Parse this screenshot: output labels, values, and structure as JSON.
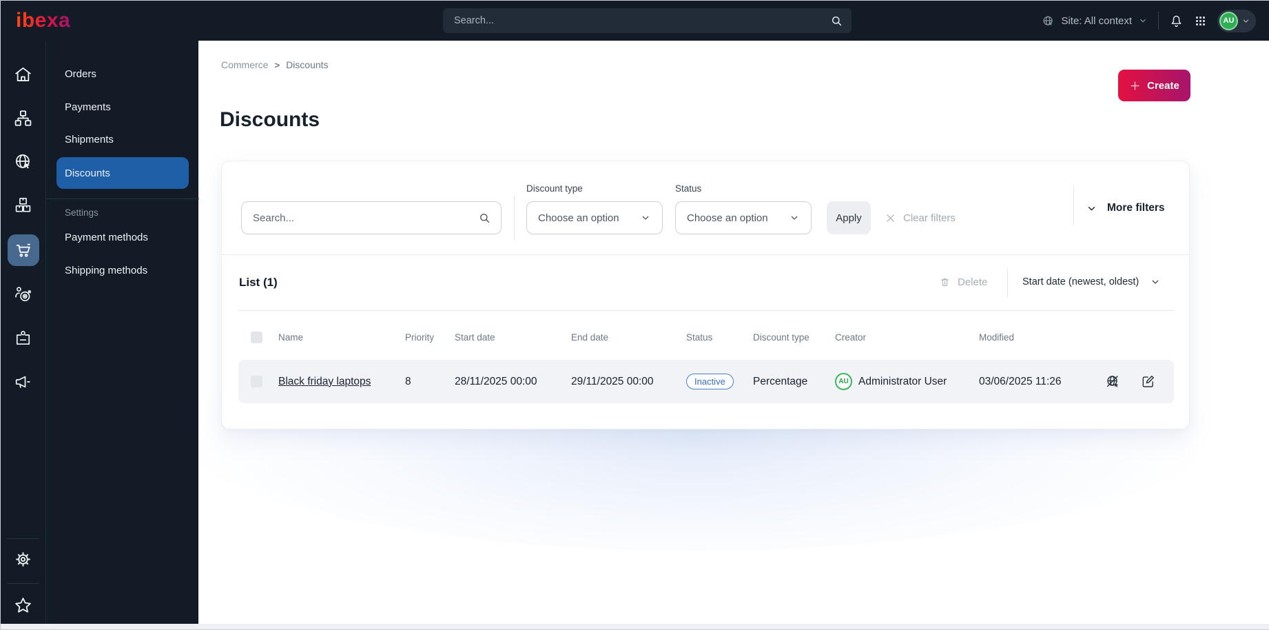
{
  "colors": {
    "topbar_bg": "#131c26",
    "brand_gradient_start": "#ff4713",
    "brand_gradient_end": "#a6156b",
    "create_gradient_start": "#e31141",
    "create_gradient_end": "#a6156b",
    "active_menu_bg": "#1f5fa8",
    "active_rail_bg": "#47698f",
    "inactive_badge_blue": "#3a6cc4",
    "avatar_green": "#2fae54",
    "row_bg": "#f2f3f6"
  },
  "topbar": {
    "logo_text": "ibexa",
    "search_placeholder": "Search...",
    "site_context_label": "Site: All context",
    "avatar_initials": "AU"
  },
  "menu": {
    "items": [
      {
        "label": "Orders"
      },
      {
        "label": "Payments"
      },
      {
        "label": "Shipments"
      },
      {
        "label": "Discounts"
      }
    ],
    "section_label": "Settings",
    "settings_items": [
      {
        "label": "Payment methods"
      },
      {
        "label": "Shipping methods"
      }
    ]
  },
  "page": {
    "breadcrumb": {
      "0": "Commerce",
      "separator": ">",
      "1": "Discounts"
    },
    "title": "Discounts",
    "create_label": "Create"
  },
  "filters": {
    "search_placeholder": "Search...",
    "discount_type_label": "Discount type",
    "discount_type_value": "Choose an option",
    "status_label": "Status",
    "status_value": "Choose an option",
    "apply_label": "Apply",
    "clear_label": "Clear filters",
    "more_label": "More filters"
  },
  "list": {
    "title": "List (1)",
    "delete_label": "Delete",
    "sort_label": "Start date (newest, oldest)",
    "columns": [
      "Name",
      "Priority",
      "Start date",
      "End date",
      "Status",
      "Discount type",
      "Creator",
      "Modified"
    ],
    "rows": [
      {
        "name": "Black friday laptops",
        "priority": "8",
        "start_date": "28/11/2025 00:00",
        "end_date": "29/11/2025 00:00",
        "status": "Inactive",
        "discount_type": "Percentage",
        "creator_initials": "AU",
        "creator": "Administrator User",
        "modified": "03/06/2025 11:26"
      }
    ]
  }
}
